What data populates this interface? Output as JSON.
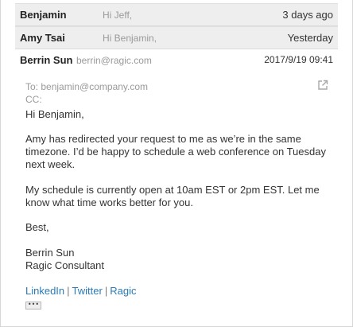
{
  "thread": [
    {
      "sender": "Benjamin",
      "snippet": "Hi Jeff,",
      "date": "3 days ago"
    },
    {
      "sender": "Amy Tsai",
      "snippet": "Hi Benjamin,",
      "date": "Yesterday"
    }
  ],
  "open_message": {
    "sender": "Berrin Sun",
    "email": "berrin@ragic.com",
    "date": "2017/9/19 09:41",
    "to": "To: benjamin@company.com",
    "cc": "CC:",
    "greeting": "Hi Benjamin,",
    "paragraph1": "Amy has redirected your request to me as we’re in the same timezone. I’d be happy to schedule a web conference on Tuesday next week.",
    "paragraph2": "My schedule is currently open at 10am EST or 2pm EST. Let me know what time works better for you.",
    "closing": "Best,",
    "signature_name": "Berrin Sun",
    "signature_title": "Ragic Consultant",
    "links": [
      "LinkedIn",
      "Twitter",
      "Ragic"
    ],
    "link_separator": "|",
    "more_label": "•••"
  },
  "icons": {
    "popout": "popout-icon"
  },
  "colors": {
    "link": "#2a7ab8",
    "row_bg": "#eeeeee",
    "muted": "#9a9a9a"
  }
}
